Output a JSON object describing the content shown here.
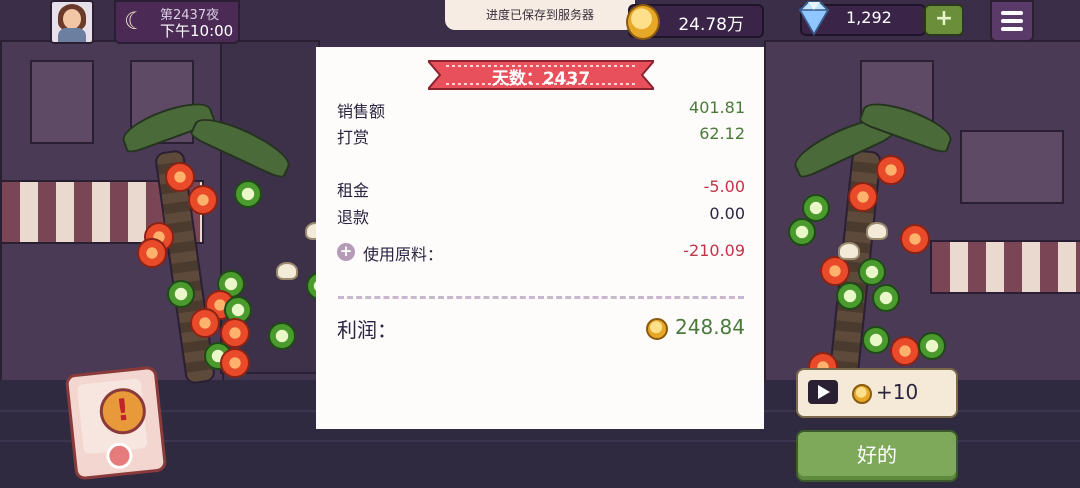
{
  "hud": {
    "night_label": "第2437夜",
    "clock": "下午10:00",
    "coins": "24.78万",
    "gems": "1,292",
    "add_gems_label": "+"
  },
  "toast": {
    "text": "进度已保存到服务器"
  },
  "receipt": {
    "day_label": "天数：2437",
    "rows": [
      {
        "label": "销售额",
        "value": "401.81"
      },
      {
        "label": "打赏",
        "value": "62.12"
      },
      {
        "label": "租金",
        "value": "-5.00"
      },
      {
        "label": "退款",
        "value": "0.00"
      },
      {
        "label": "使用原料：",
        "value": "-210.09"
      }
    ],
    "profit_label": "利润：",
    "profit_value": "248.84"
  },
  "buttons": {
    "video_reward": "+10",
    "ok": "好的"
  },
  "colors": {
    "positive": "#4a7a3a",
    "negative": "#c0344a",
    "ribbon": "#e8505b",
    "ok_button": "#7ea85a"
  },
  "icons": [
    "moon-icon",
    "coin-icon",
    "diamond-icon",
    "plus-icon",
    "menu-icon",
    "alert-icon",
    "play-icon"
  ]
}
